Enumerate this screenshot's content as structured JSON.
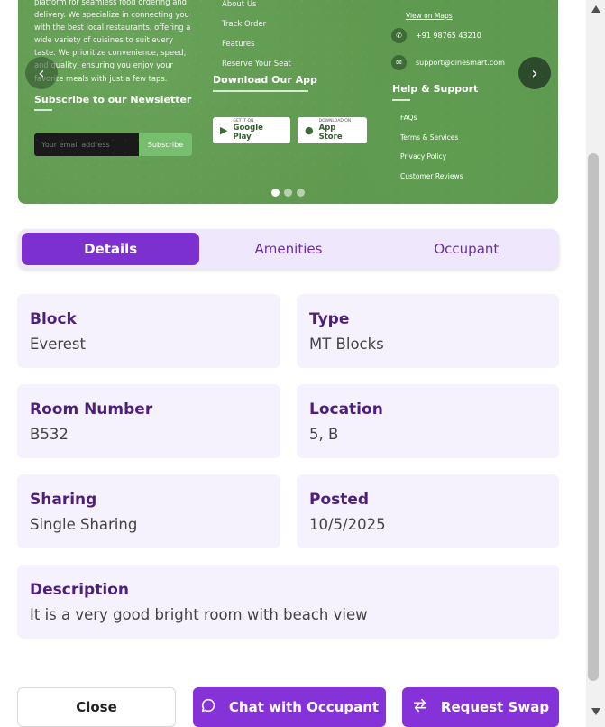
{
  "carousel": {
    "about_text": "platform for seamless food ordering and delivery. We specialize in connecting you with the best local restaurants, offering a wide variety of cuisines to suit every taste. We prioritize convenience, speed, and quality, ensuring you enjoy your favorite meals with just a few taps.",
    "newsletter_title": "Subscribe to our Newsletter",
    "email_placeholder": "Your email address",
    "subscribe_label": "Subscribe",
    "links": [
      "About Us",
      "Track Order",
      "Features",
      "Reserve Your Seat"
    ],
    "download_title": "Download Our App",
    "google_small": "GET IT ON",
    "google_big": "Google Play",
    "apple_small": "DOWNLOAD ON",
    "apple_big": "App Store",
    "map_link": "View on Maps",
    "phone": "+91 98765 43210",
    "email": "support@dinesmart.com",
    "help_title": "Help & Support",
    "help_links": [
      "FAQs",
      "Terms & Services",
      "Privacy Policy",
      "Customer Reviews"
    ],
    "prev_icon": "chevron-left",
    "next_icon": "chevron-right",
    "dot_count": 3,
    "active_dot": 1
  },
  "tabs": [
    {
      "label": "Details",
      "active": true
    },
    {
      "label": "Amenities",
      "active": false
    },
    {
      "label": "Occupant",
      "active": false
    }
  ],
  "details": {
    "block": {
      "label": "Block",
      "value": "Everest"
    },
    "type": {
      "label": "Type",
      "value": "MT Blocks"
    },
    "room": {
      "label": "Room Number",
      "value": "B532"
    },
    "location": {
      "label": "Location",
      "value": "5, B"
    },
    "sharing": {
      "label": "Sharing",
      "value": "Single Sharing"
    },
    "posted": {
      "label": "Posted",
      "value": "10/5/2025"
    },
    "description": {
      "label": "Description",
      "value": "It is a very good bright room with beach view"
    }
  },
  "actions": {
    "close_label": "Close",
    "chat_label": "Chat with Occupant",
    "swap_label": "Request Swap"
  },
  "colors": {
    "accent": "#8632d9",
    "tab_bg": "#efe7fb",
    "card_bg": "#f5f1fd",
    "label_color": "#4e1f7a",
    "carousel_green": "#5e984f"
  }
}
